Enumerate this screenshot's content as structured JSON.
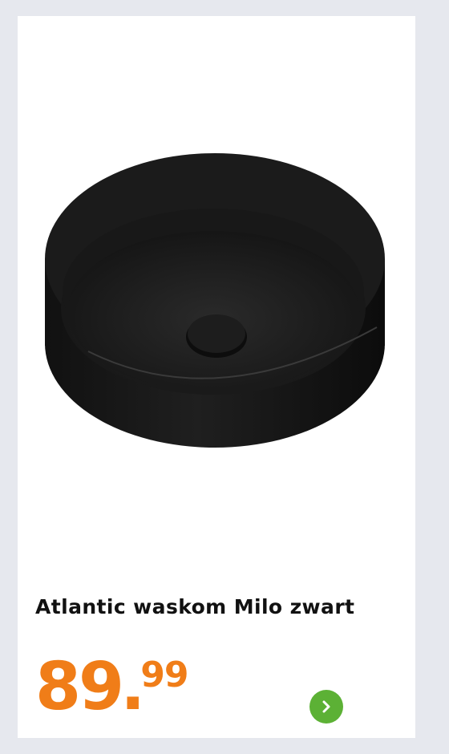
{
  "product": {
    "title": "Atlantic waskom Milo zwart",
    "image_icon": "black-round-washbasin",
    "price": {
      "whole": "89",
      "separator": ".",
      "cents": "99"
    },
    "next_icon": "chevron-right-icon"
  },
  "colors": {
    "background": "#e6e8ee",
    "card": "#ffffff",
    "price": "#f07d18",
    "button": "#5cb135"
  }
}
